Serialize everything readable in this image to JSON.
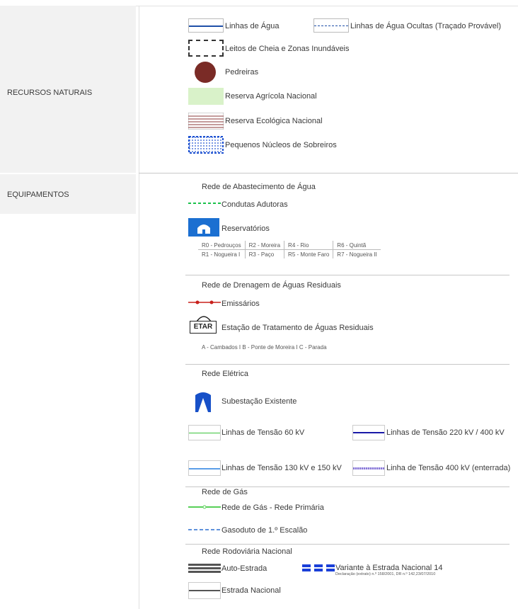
{
  "categories": {
    "natural": "RECURSOS NATURAIS",
    "equip": "EQUIPAMENTOS"
  },
  "natural_items": {
    "linhas_agua": "Linhas de Água",
    "linhas_agua_ocultas": "Linhas de Água Ocultas (Traçado Provável)",
    "leitos_cheia": "Leitos de Cheia e Zonas Inundáveis",
    "pedreiras": "Pedreiras",
    "ran": "Reserva Agrícola Nacional",
    "ren": "Reserva Ecológica Nacional",
    "sobreiros": "Pequenos Núcleos de Sobreiros"
  },
  "agua": {
    "title": "Rede de Abastecimento de Água",
    "condutas": "Condutas Adutoras",
    "reservatorios": "Reservatórios",
    "table": [
      [
        "R0 - Pedrouços",
        "R2 - Moreira",
        "R4 - Rio",
        "R6 - Quintã"
      ],
      [
        "R1 - Nogueira I",
        "R3 - Paço",
        "R5 - Monte Faro",
        "R7 - Nogueira II"
      ]
    ]
  },
  "drenagem": {
    "title": "Rede de Drenagem de Águas Residuais",
    "emissarios": "Emissários",
    "etar_badge": "ETAR",
    "etar": "Estação de Tratamento de Águas Residuais",
    "etar_list": "A - Cambados I B - Ponte de Moreira I C - Parada"
  },
  "eletrica": {
    "title": "Rede Elétrica",
    "subestacao": "Subestação Existente",
    "l60": "Linhas de Tensão 60 kV",
    "l220": "Linhas de Tensão 220 kV / 400 kV",
    "l130": "Linhas de Tensão 130 kV e 150 kV",
    "l400": "Linha de Tensão 400 kV (enterrada)"
  },
  "gas": {
    "title": "Rede de Gás",
    "primaria": "Rede de Gás - Rede Primária",
    "gasoduto": "Gasoduto de 1.º Escalão"
  },
  "rodoviaria": {
    "title": "Rede Rodoviária Nacional",
    "auto": "Auto-Estrada",
    "variante": "Variante à Estrada Nacional 14",
    "variante_note": "Declaração (extrato) n.º 158/2001, DR n.º 142,23/07/2010",
    "nacional": "Estrada Nacional"
  },
  "colors": {
    "water": "#1f4fa8",
    "pedreira": "#7a2b26",
    "ran": "#d9f2c9",
    "condutas": "#19c24a",
    "reservatorio": "#1b6fd1",
    "emissario": "#c8201c",
    "l60": "#3cc43c",
    "l220": "#1a1aa8",
    "l130": "#5b9ee8",
    "l400": "#8a7ad8",
    "gas_primary": "#58d058",
    "gasoduto": "#2a6fd0",
    "road": "#555555",
    "variante": "#1a3fd8"
  }
}
